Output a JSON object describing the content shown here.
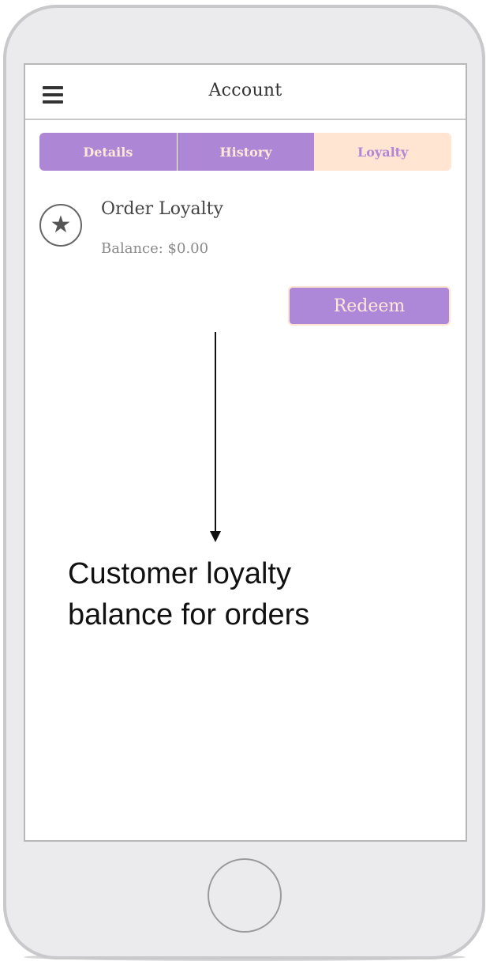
{
  "header": {
    "title": "Account"
  },
  "tabs": [
    {
      "label": "Details",
      "selected": false
    },
    {
      "label": "History",
      "selected": false
    },
    {
      "label": "Loyalty",
      "selected": true
    }
  ],
  "loyalty": {
    "icon": "star-icon",
    "name": "Order Loyalty",
    "balance": "Balance: $0.00"
  },
  "actions": {
    "redeem_label": "Redeem"
  },
  "annotation": {
    "line1": "Customer loyalty",
    "line2": "balance for orders"
  },
  "colors": {
    "accent": "#ad87d6",
    "accent_light": "#ffe5d2",
    "text": "#333333"
  }
}
